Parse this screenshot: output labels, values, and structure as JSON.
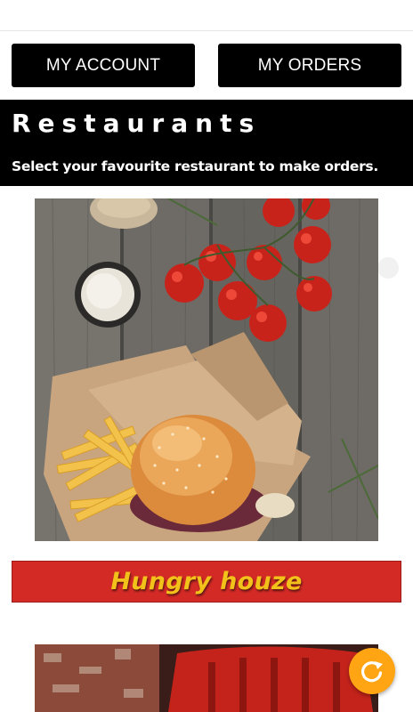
{
  "nav": {
    "account_label": "MY ACCOUNT",
    "orders_label": "MY ORDERS"
  },
  "header": {
    "title": "Restaurants",
    "subtitle": "Select your favourite restaurant to make orders."
  },
  "restaurants": [
    {
      "name": "Hungry houze",
      "image_icon": "burger-fries-photo"
    },
    {
      "name": "",
      "image_icon": "restaurant-chairs-photo"
    }
  ],
  "refresh_icon": "refresh-icon",
  "colors": {
    "nav_bg": "#000000",
    "banner_red": "#d32a26",
    "banner_text": "#f2c21a",
    "fab_orange": "#ffa514"
  }
}
